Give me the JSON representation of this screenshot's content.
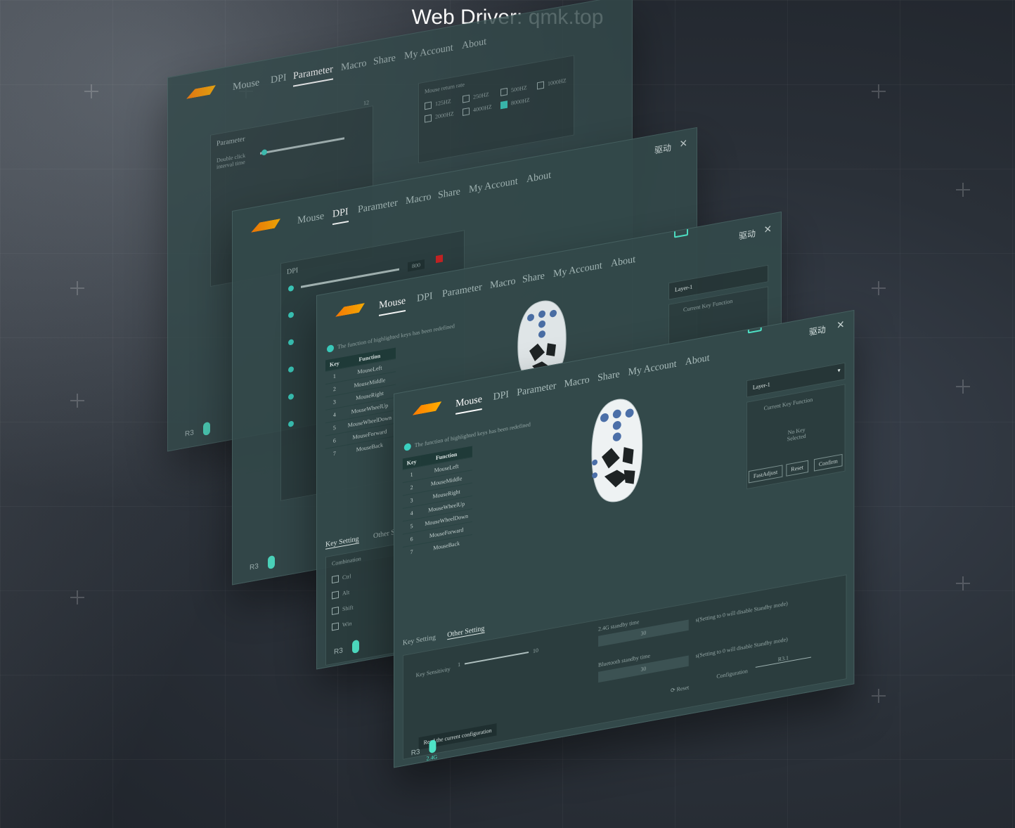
{
  "caption": {
    "line1": "",
    "line2": "Web Driver: qmk.top"
  },
  "app": {
    "logo_cn": "驱动",
    "close": "×",
    "nav": [
      "Mouse",
      "DPI",
      "Parameter",
      "Macro",
      "Share",
      "My Account",
      "About"
    ]
  },
  "panel_parameter": {
    "active_tab": "Parameter",
    "parameter_heading": "Parameter",
    "double_click": "Double click interval time",
    "slider_max": "12",
    "return_rate_title": "Mouse return rate",
    "rates": [
      {
        "label": "125HZ",
        "checked": false
      },
      {
        "label": "250HZ",
        "checked": false
      },
      {
        "label": "500HZ",
        "checked": false
      },
      {
        "label": "1000HZ",
        "checked": false
      },
      {
        "label": "2000HZ",
        "checked": false
      },
      {
        "label": "4000HZ",
        "checked": false
      },
      {
        "label": "8000HZ",
        "checked": true
      }
    ],
    "footer": "R3"
  },
  "panel_dpi": {
    "active_tab": "DPI",
    "dpi_label": "DPI",
    "dpi_value": "800",
    "footer": "R3"
  },
  "panel_mouse_back": {
    "active_tab": "Mouse",
    "hint": "The function of highlighted keys has been redefined",
    "table_headers": [
      "Key",
      "Function"
    ],
    "keys": [
      "1",
      "2",
      "3",
      "4",
      "5",
      "6",
      "7"
    ],
    "functions": [
      "MouseLeft",
      "MouseMiddle",
      "MouseRight",
      "MouseWheelUp",
      "MouseWheelDown",
      "MouseForward",
      "MouseBack"
    ],
    "tab_key": "Key Setting",
    "tab_other": "Other Setting",
    "combination": "Combination",
    "modifiers": [
      "Ctrl",
      "Alt",
      "Shift",
      "Win"
    ],
    "layer": "Layer-1",
    "current_key": "Current Key Function",
    "footer": "R3"
  },
  "panel_front": {
    "active_tab": "Mouse",
    "hint": "The function of highlighted keys has been redefined",
    "table_headers": [
      "Key",
      "Function"
    ],
    "keys": [
      "1",
      "2",
      "3",
      "4",
      "5",
      "6",
      "7"
    ],
    "functions": [
      "MouseLeft",
      "MouseMiddle",
      "MouseRight",
      "MouseWheelUp",
      "MouseWheelDown",
      "MouseForward",
      "MouseBack"
    ],
    "layer": "Layer-1",
    "current_key": "Current Key Function",
    "no_key": "No Key Selected",
    "btn_fast": "FastAdjust",
    "btn_reset": "Reset",
    "btn_confirm": "Confirm",
    "tab_key": "Key Setting",
    "tab_other": "Other Setting",
    "key_sensitivity": "Key Sensitivity",
    "sens_min": "1",
    "sens_max": "10",
    "standby_24g": "2.4G standby time",
    "standby_24g_value": "30",
    "standby_24g_note": "s(Setting to 0 will disable Standby mode)",
    "standby_bt": "Bluetooth standby time",
    "standby_bt_value": "30",
    "standby_bt_note": "s(Setting to 0 will disable Standby mode)",
    "reset": "Reset",
    "configuration": "Configuration",
    "configuration_value": "R3.1",
    "read_config": "Read the current configuration",
    "footer": "R3",
    "footer_mode": "2.4G"
  },
  "colors": {
    "panel": "#33494a",
    "accent": "#3ad0c0",
    "logo": "#ff8c00"
  }
}
